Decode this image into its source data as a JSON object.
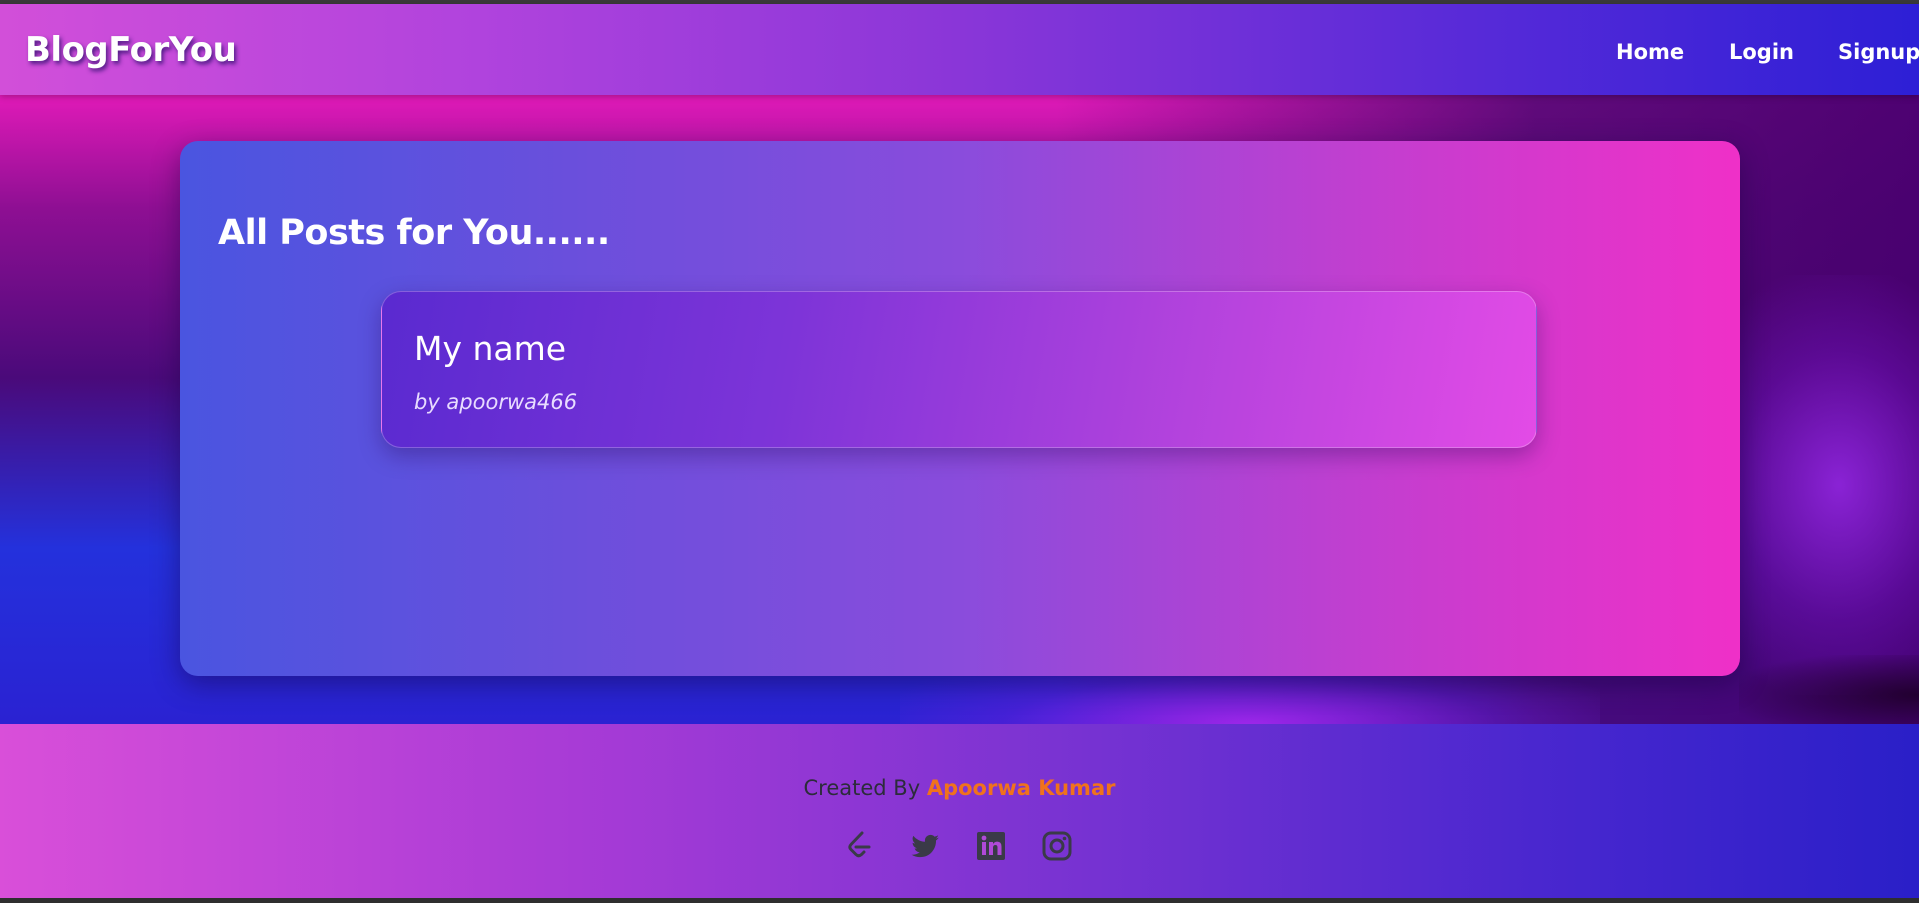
{
  "navbar": {
    "brand": "BlogForYou",
    "links": [
      "Home",
      "Login",
      "Signup"
    ]
  },
  "main": {
    "heading": "All Posts for You......",
    "posts": [
      {
        "title": "My name",
        "author": "by apoorwa466"
      }
    ]
  },
  "footer": {
    "created_by_label": "Created By",
    "author_name": "Apoorwa Kumar",
    "social_icons": [
      "leetcode-icon",
      "twitter-icon",
      "linkedin-icon",
      "instagram-icon"
    ]
  },
  "colors": {
    "accent": "#f0721c",
    "text_primary": "#ffffff",
    "footer_text": "#2c2c3a"
  }
}
